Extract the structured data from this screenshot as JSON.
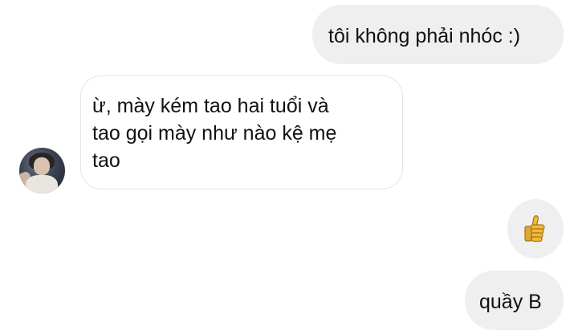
{
  "messages": [
    {
      "direction": "outgoing",
      "text": "tôi không phải nhóc :)"
    },
    {
      "direction": "incoming",
      "lines": [
        "ừ, mày kém tao hai tuổi và",
        "tao gọi mày như nào kệ mẹ",
        "tao"
      ]
    },
    {
      "direction": "outgoing",
      "icon": "thumbs-up-icon"
    },
    {
      "direction": "outgoing",
      "text": "quầy B"
    }
  ],
  "colors": {
    "outgoing_bubble": "#efefef",
    "incoming_border": "#e4e4e4",
    "thumbs_up": "#f2b93b"
  }
}
